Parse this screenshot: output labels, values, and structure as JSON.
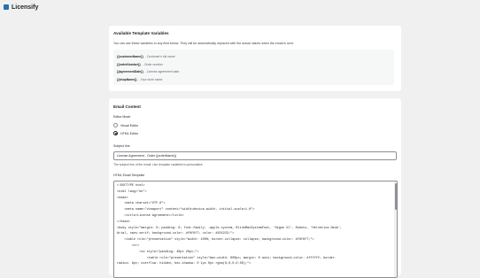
{
  "app": {
    "name": "Licensify",
    "brand_color": "#2271b1",
    "logo_icon": "logo-icon"
  },
  "variables_card": {
    "title": "Available Template Variables",
    "description": "You can use these variables in any field below. They will be automatically replaced with the actual values when the email is sent.",
    "items": [
      {
        "code": "{{customerName}}",
        "desc": "- Customer's full name"
      },
      {
        "code": "{{orderNumber}}",
        "desc": "- Order number"
      },
      {
        "code": "{{agreementDate}}",
        "desc": "- License agreement date"
      },
      {
        "code": "{{shopName}}",
        "desc": "- Your store name"
      }
    ]
  },
  "email_card": {
    "title": "Email Content",
    "mode_label": "Editor Mode",
    "modes": [
      {
        "label": "Visual Editor",
        "checked": false
      },
      {
        "label": "HTML Editor",
        "checked": true
      }
    ],
    "subject_label": "Subject line",
    "subject_value": "License Agreement - Order {{orderName}}",
    "subject_help": "The subject line of the email. Use template variables to personalize.",
    "html_label": "HTML Email Template",
    "html_lines": [
      "<!DOCTYPE html>",
      "<html lang=\"en\">",
      "<head>",
      "    <meta charset=\"UTF-8\">",
      "    <meta name=\"viewport\" content=\"width=device-width, initial-scale=1.0\">",
      "    <title>License Agreement</title>",
      "</head>",
      "<body style=\"margin: 0; padding: 0; font-family: -apple-system, BlinkMacSystemFont, 'Segoe UI', Roboto, 'Helvetica Neue',",
      "Arial, sans-serif; background-color: #f6f6f7; color: #202223;\">",
      "    <table role=\"presentation\" style=\"width: 100%; border-collapse: collapse; background-color: #f6f6f7;\">",
      "        <tr>",
      "            <td style=\"padding: 40px 20px;\">",
      "                <table role=\"presentation\" style=\"max-width: 600px; margin: 0 auto; background-color: #ffffff; border-",
      "radius: 8px; overflow: hidden; box-shadow: 0 1px 0px rgba(0,0,0,0.08);\">"
    ]
  }
}
